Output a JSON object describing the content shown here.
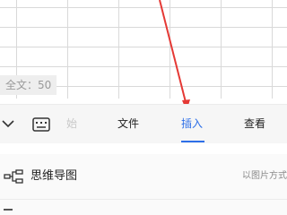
{
  "status": {
    "word_count": "全文：50"
  },
  "toolbar": {
    "tabs": [
      {
        "label": "始"
      },
      {
        "label": "文件"
      },
      {
        "label": "插入"
      },
      {
        "label": "查看"
      }
    ],
    "active_tab": "插入",
    "accent_color": "#2d6fe8"
  },
  "menu": {
    "mind_map": {
      "label": "思维导图",
      "hint": "以图片方式"
    }
  },
  "annotation_color": "#e53935"
}
